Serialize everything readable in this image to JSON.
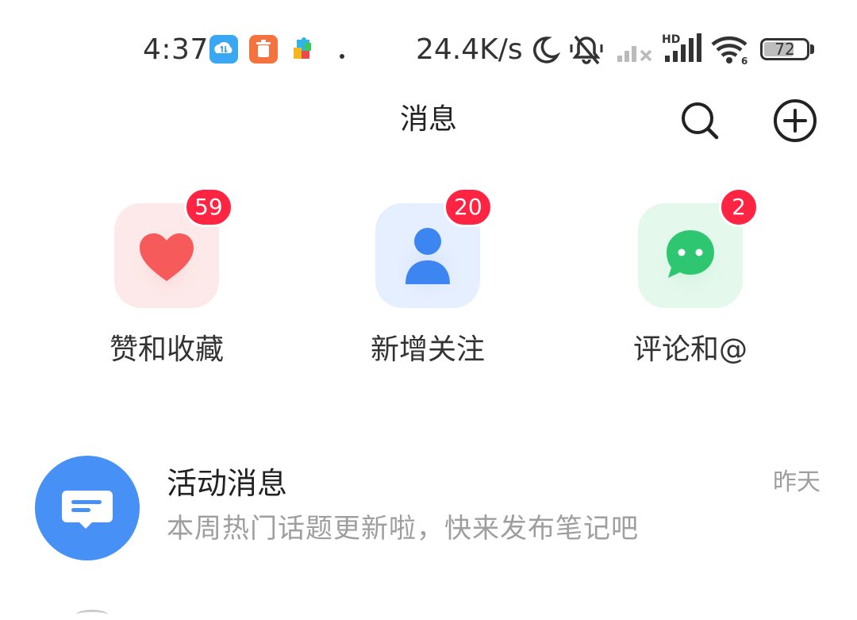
{
  "status_bar": {
    "time": "4:37",
    "network_speed": "24.4K/s",
    "battery_level": "72",
    "battery_fraction": 0.72,
    "network_type": "HD",
    "notification_icons": [
      "cloud-sync-icon",
      "trash-app-icon",
      "puzzle-app-icon",
      "dot-icon"
    ],
    "status_icons": [
      "moon-icon",
      "mute-icon",
      "signal-1-icon",
      "signal-2-icon",
      "wifi-icon",
      "battery-icon"
    ]
  },
  "header": {
    "title": "消息",
    "search_icon": "search-icon",
    "add_icon": "plus-circle-icon"
  },
  "categories": [
    {
      "label": "赞和收藏",
      "badge": "59",
      "icon": "heart-icon",
      "bg_color": "#fde9e9",
      "icon_color": "#f65a5a"
    },
    {
      "label": "新增关注",
      "badge": "20",
      "icon": "person-icon",
      "bg_color": "#e6efff",
      "icon_color": "#3d86f2"
    },
    {
      "label": "评论和@",
      "badge": "2",
      "icon": "chat-bubble-icon",
      "bg_color": "#e4f8ec",
      "icon_color": "#2fc671"
    }
  ],
  "messages": [
    {
      "title": "活动消息",
      "time": "昨天",
      "preview": "本周热门话题更新啦，快来发布笔记吧",
      "icon": "message-icon",
      "avatar_color": "#4790f5"
    }
  ],
  "colors": {
    "badge": "#ff2442",
    "text_primary": "#222222",
    "text_secondary": "#9e9e9e"
  }
}
